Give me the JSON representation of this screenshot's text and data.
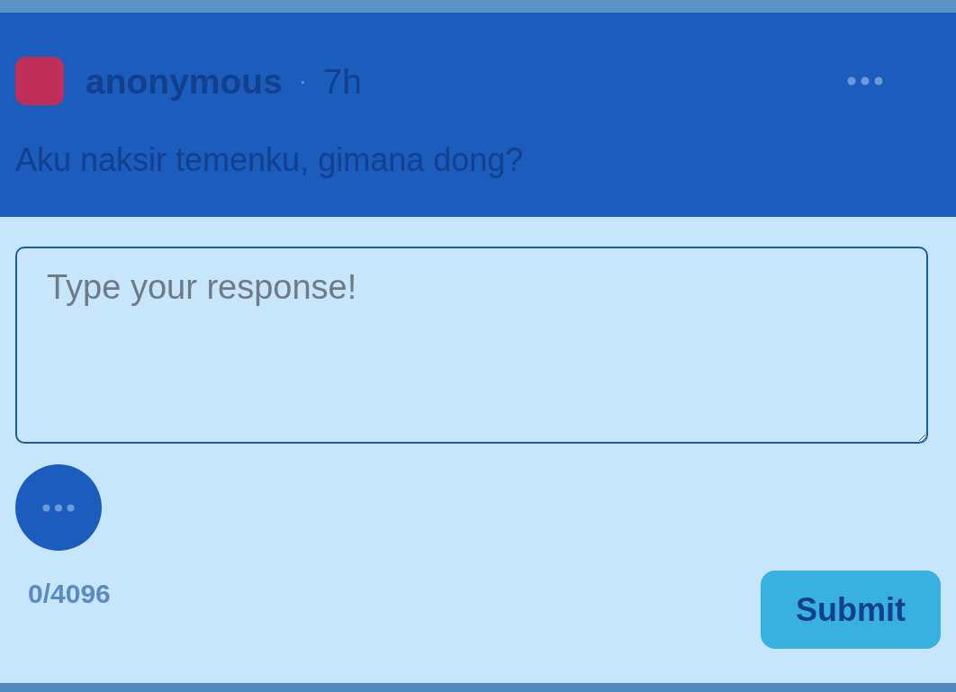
{
  "post": {
    "author": "anonymous",
    "separator": "·",
    "time": "7h",
    "question": "Aku naksir temenku, gimana dong?"
  },
  "reply": {
    "placeholder": "Type your response!",
    "counter": "0/4096",
    "submit": "Submit"
  }
}
